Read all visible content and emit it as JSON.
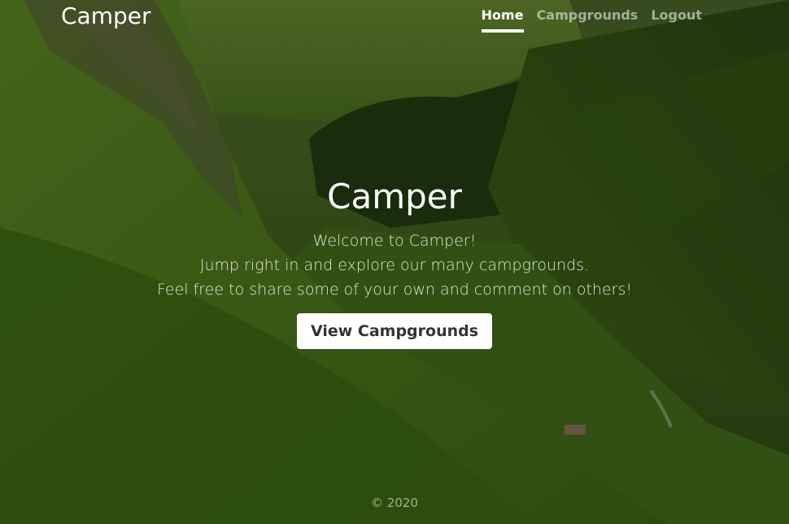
{
  "navbar": {
    "brand": "Camper",
    "links": [
      {
        "label": "Home",
        "active": true
      },
      {
        "label": "Campgrounds",
        "active": false
      },
      {
        "label": "Logout",
        "active": false
      }
    ]
  },
  "hero": {
    "title": "Camper",
    "lines": [
      "Welcome to Camper!",
      "Jump right in and explore our many campgrounds.",
      "Feel free to share some of your own and comment on others!"
    ],
    "button_label": "View Campgrounds"
  },
  "footer": {
    "text": "© 2020"
  },
  "colors": {
    "accent": "#ffffff",
    "button_text": "#333333",
    "inactive_link": "#a8a8a8"
  },
  "background": {
    "image_description_icon": "mountain-valley-photo"
  }
}
